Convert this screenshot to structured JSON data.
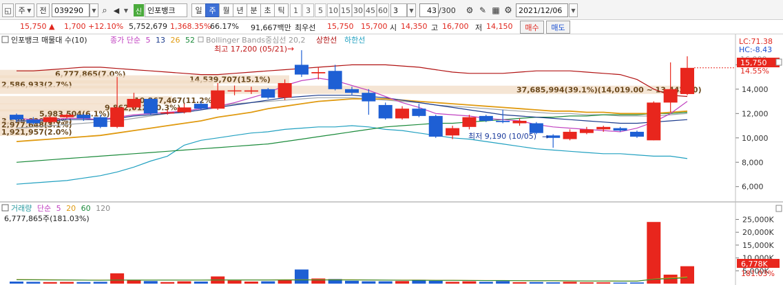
{
  "toolbar": {
    "period_dd": "주",
    "prev_label": "전",
    "code": "039290",
    "credit_tag": "신",
    "name": "인포뱅크",
    "periods": [
      "일",
      "주",
      "월",
      "년",
      "분",
      "초",
      "틱"
    ],
    "selected_period": "주",
    "nums": [
      "1",
      "3",
      "5",
      "10",
      "15",
      "30",
      "45",
      "60"
    ],
    "count": "3",
    "page": "43",
    "page_total": "/300",
    "date": "2021/12/06"
  },
  "quote": {
    "price": "15,750",
    "change": "1,700",
    "change_pct": "+12.10%",
    "volume": "5,752,679",
    "vol_ratio": "1,368.35%",
    "turnover": "66.17%",
    "amount": "91,667백만",
    "pre_label": "최우선",
    "bid1": "15,750",
    "bid2": "15,700",
    "open_label": "시",
    "open": "14,350",
    "high_label": "고",
    "high": "16,700",
    "low_label": "저",
    "low": "14,150",
    "buy": "매수",
    "sell": "매도"
  },
  "colors": {
    "up": "#e8261d",
    "down": "#1e5fd4",
    "ma5": "#c040c0",
    "ma13": "#1a3a8c",
    "ma26": "#e09a10",
    "ma52": "#1a8a3a",
    "bb_up": "#b01010",
    "bb_dn": "#20a0c0",
    "band": "#f2dcc6"
  },
  "legend": {
    "title": "인포뱅크 매물대 수(10)",
    "close_ma": "종가 단순",
    "ma5": "5",
    "ma13": "13",
    "ma26": "26",
    "ma52": "52",
    "bb": "Bollinger Bands중심선 20,2",
    "bb_up": "상한선",
    "bb_dn": "하한선",
    "vol_title": "거래량",
    "vol_ma": "단순",
    "vma5": "5",
    "vma20": "20",
    "vma60": "60",
    "vma120": "120",
    "vol_last": "6,777,865주(181.03%)"
  },
  "labels": {
    "lc": "LC:71.38",
    "hc": "HC:-8.43",
    "high_note": "최고 17,200 (05/21)",
    "low_note": "최저 9,190 (10/05)",
    "price_tag": "15,750",
    "price_pct": "14.55%",
    "top_tick": "16,000",
    "vol_tag": "6,778K",
    "vol_pct": "181.03%"
  },
  "chart_data": {
    "type": "candlestick",
    "price_axis": {
      "ticks": [
        6000,
        8000,
        10000,
        12000,
        14000,
        16000
      ],
      "tick_labels": [
        "6,000",
        "8,000",
        "10,000",
        "12,000",
        "14,000",
        "16,000"
      ]
    },
    "volume_axis": {
      "ticks": [
        5000,
        10000,
        15000,
        20000,
        25000
      ],
      "tick_labels": [
        "5,000K",
        "10,000K",
        "15,000K",
        "20,000K",
        "25,000K"
      ]
    },
    "volume_profile": [
      {
        "label": "6,777,865(7.0%)",
        "price": 15250
      },
      {
        "label": "14,539,707(15.1%)",
        "price": 14800
      },
      {
        "label": "2,586,933(2.7%)",
        "price": 14400
      },
      {
        "label": "37,685,994(39.1%)(14,019.00 ~ 13,442.00)",
        "price": 13950
      },
      {
        "label": "10,867,467(11.2%)",
        "price": 13100
      },
      {
        "label": "9,862,012(10.3%)",
        "price": 12500
      },
      {
        "label": "5,983,504(6.1%)",
        "price": 12000
      },
      {
        "label": "3,688,820(3.8%)",
        "price": 11400
      },
      {
        "label": "2,977,648(3.1%)",
        "price": 11100
      },
      {
        "label": "1,921,957(2.0%)",
        "price": 10500
      }
    ],
    "candles": [
      {
        "o": 11900,
        "c": 11500,
        "h": 12000,
        "l": 11300,
        "v": 800
      },
      {
        "o": 11500,
        "c": 11200,
        "h": 11700,
        "l": 11100,
        "v": 700
      },
      {
        "o": 11300,
        "c": 11700,
        "h": 11800,
        "l": 11200,
        "v": 600
      },
      {
        "o": 11700,
        "c": 11900,
        "h": 12000,
        "l": 11600,
        "v": 650
      },
      {
        "o": 11900,
        "c": 11600,
        "h": 12000,
        "l": 11400,
        "v": 600
      },
      {
        "o": 11700,
        "c": 10900,
        "h": 11900,
        "l": 10800,
        "v": 700
      },
      {
        "o": 10900,
        "c": 12500,
        "h": 15000,
        "l": 10800,
        "v": 4000
      },
      {
        "o": 12500,
        "c": 13200,
        "h": 13700,
        "l": 12300,
        "v": 1500
      },
      {
        "o": 13200,
        "c": 12000,
        "h": 13300,
        "l": 11900,
        "v": 1000
      },
      {
        "o": 12000,
        "c": 12100,
        "h": 12300,
        "l": 11900,
        "v": 600
      },
      {
        "o": 12100,
        "c": 12500,
        "h": 12800,
        "l": 12000,
        "v": 900
      },
      {
        "o": 12800,
        "c": 12400,
        "h": 13000,
        "l": 12300,
        "v": 800
      },
      {
        "o": 12400,
        "c": 13900,
        "h": 14500,
        "l": 12300,
        "v": 2800
      },
      {
        "o": 13900,
        "c": 13900,
        "h": 14300,
        "l": 13500,
        "v": 1200
      },
      {
        "o": 13800,
        "c": 13900,
        "h": 14200,
        "l": 13600,
        "v": 800
      },
      {
        "o": 14000,
        "c": 13300,
        "h": 14100,
        "l": 13200,
        "v": 900
      },
      {
        "o": 13300,
        "c": 14500,
        "h": 14800,
        "l": 13100,
        "v": 1500
      },
      {
        "o": 16000,
        "c": 15200,
        "h": 17200,
        "l": 15000,
        "v": 5500
      },
      {
        "o": 15300,
        "c": 15400,
        "h": 15800,
        "l": 14800,
        "v": 2000
      },
      {
        "o": 15500,
        "c": 14000,
        "h": 16000,
        "l": 13900,
        "v": 1800
      },
      {
        "o": 14000,
        "c": 13700,
        "h": 14200,
        "l": 13500,
        "v": 1100
      },
      {
        "o": 13700,
        "c": 13000,
        "h": 14000,
        "l": 11900,
        "v": 900
      },
      {
        "o": 12700,
        "c": 11600,
        "h": 12900,
        "l": 11500,
        "v": 900
      },
      {
        "o": 11600,
        "c": 12400,
        "h": 12600,
        "l": 11500,
        "v": 1000
      },
      {
        "o": 12400,
        "c": 11800,
        "h": 12800,
        "l": 11700,
        "v": 1500
      },
      {
        "o": 11800,
        "c": 10100,
        "h": 11900,
        "l": 10000,
        "v": 1100
      },
      {
        "o": 10200,
        "c": 10800,
        "h": 11000,
        "l": 9900,
        "v": 700
      },
      {
        "o": 10900,
        "c": 11700,
        "h": 11900,
        "l": 10700,
        "v": 900
      },
      {
        "o": 11800,
        "c": 11400,
        "h": 11900,
        "l": 11300,
        "v": 700
      },
      {
        "o": 11400,
        "c": 11300,
        "h": 12300,
        "l": 11200,
        "v": 1000
      },
      {
        "o": 11200,
        "c": 11400,
        "h": 11600,
        "l": 11000,
        "v": 550
      },
      {
        "o": 11200,
        "c": 10400,
        "h": 11300,
        "l": 10300,
        "v": 600
      },
      {
        "o": 10200,
        "c": 10000,
        "h": 10300,
        "l": 9190,
        "v": 500
      },
      {
        "o": 9900,
        "c": 10500,
        "h": 10700,
        "l": 9800,
        "v": 700
      },
      {
        "o": 10400,
        "c": 10700,
        "h": 10900,
        "l": 10300,
        "v": 500
      },
      {
        "o": 10700,
        "c": 10900,
        "h": 11000,
        "l": 10500,
        "v": 500
      },
      {
        "o": 10800,
        "c": 10600,
        "h": 10900,
        "l": 10500,
        "v": 400
      },
      {
        "o": 10500,
        "c": 10100,
        "h": 10600,
        "l": 10000,
        "v": 450
      },
      {
        "o": 9800,
        "c": 12900,
        "h": 13000,
        "l": 9800,
        "v": 24000
      },
      {
        "o": 12900,
        "c": 14000,
        "h": 16200,
        "l": 12100,
        "v": 3500
      },
      {
        "o": 13600,
        "c": 15750,
        "h": 16700,
        "l": 13500,
        "v": 6778
      }
    ],
    "bb_upper": [
      15500,
      15500,
      15600,
      15700,
      15800,
      15800,
      15700,
      15600,
      15500,
      15400,
      15300,
      15200,
      15200,
      15300,
      15400,
      15500,
      15600,
      15700,
      15800,
      15900,
      16000,
      16000,
      16000,
      15900,
      15800,
      15600,
      15400,
      15300,
      15300,
      15300,
      15400,
      15500,
      15500,
      15500,
      15400,
      15300,
      15200,
      14800,
      14000,
      13500,
      13400
    ],
    "bb_lower": [
      6200,
      6300,
      6400,
      6500,
      6700,
      6900,
      7200,
      7600,
      8100,
      8500,
      9400,
      9800,
      10000,
      10200,
      10400,
      10500,
      10700,
      10800,
      10900,
      10900,
      11000,
      10900,
      10700,
      10600,
      10400,
      10200,
      10000,
      9900,
      9700,
      9500,
      9300,
      9100,
      9000,
      8900,
      8800,
      8700,
      8700,
      8600,
      8500,
      8500,
      8300
    ],
    "ma5": [
      11600,
      11500,
      11500,
      11600,
      11600,
      11500,
      11700,
      11900,
      12000,
      12100,
      12200,
      12400,
      12600,
      12900,
      13300,
      13700,
      14300,
      14700,
      14900,
      14700,
      14300,
      13900,
      13400,
      12900,
      12500,
      12000,
      11900,
      11800,
      11600,
      11500,
      11400,
      11100,
      10900,
      10800,
      10700,
      10600,
      10500,
      10800,
      11300,
      12000,
      13000
    ],
    "ma13": [
      11400,
      11400,
      11400,
      11500,
      11500,
      11500,
      11600,
      11800,
      11900,
      12000,
      12100,
      12300,
      12500,
      12700,
      12900,
      13100,
      13300,
      13400,
      13500,
      13500,
      13500,
      13400,
      13300,
      13100,
      12900,
      12700,
      12500,
      12300,
      12100,
      11900,
      11800,
      11700,
      11600,
      11500,
      11400,
      11300,
      11200,
      11200,
      11300,
      11400,
      11500
    ],
    "ma26": [
      9700,
      9800,
      9900,
      10000,
      10100,
      10200,
      10400,
      10600,
      10800,
      11000,
      11200,
      11400,
      11700,
      11900,
      12100,
      12400,
      12600,
      12800,
      13000,
      13100,
      13200,
      13200,
      13200,
      13100,
      13000,
      12900,
      12800,
      12700,
      12600,
      12500,
      12400,
      12300,
      12200,
      12200,
      12100,
      12100,
      12000,
      12000,
      12000,
      12100,
      12200
    ],
    "ma52": [
      8000,
      8100,
      8200,
      8300,
      8400,
      8500,
      8600,
      8700,
      8800,
      8900,
      9000,
      9100,
      9200,
      9300,
      9400,
      9500,
      9700,
      9900,
      10100,
      10300,
      10500,
      10700,
      10900,
      11000,
      11100,
      11200,
      11200,
      11300,
      11400,
      11500,
      11600,
      11700,
      11700,
      11800,
      11800,
      11900,
      11900,
      11900,
      12000,
      12000,
      12100
    ],
    "bb_mid": [
      10800,
      10900,
      11000,
      11100,
      11200,
      11300,
      11400,
      11600,
      11800,
      12000,
      12200,
      12400,
      12600,
      12800,
      12900,
      13000,
      13100,
      13200,
      13300,
      13300,
      13300,
      13200,
      13100,
      13000,
      12900,
      12700,
      12600,
      12500,
      12400,
      12300,
      12200,
      12100,
      12000,
      12000,
      11900,
      11900,
      11800,
      11800,
      11800,
      11900,
      12000
    ],
    "vol_ma": [
      1600,
      1550,
      1500,
      1450,
      1400,
      1350,
      1400,
      1400,
      1400,
      1400,
      1400,
      1400,
      1450,
      1450,
      1450,
      1450,
      1500,
      1500,
      1500,
      1500,
      1500,
      1450,
      1400,
      1350,
      1350,
      1300,
      1300,
      1250,
      1200,
      1200,
      1150,
      1100,
      1100,
      1050,
      1000,
      1000,
      950,
      950,
      1800,
      2200,
      2600
    ],
    "last_close": 15750
  }
}
